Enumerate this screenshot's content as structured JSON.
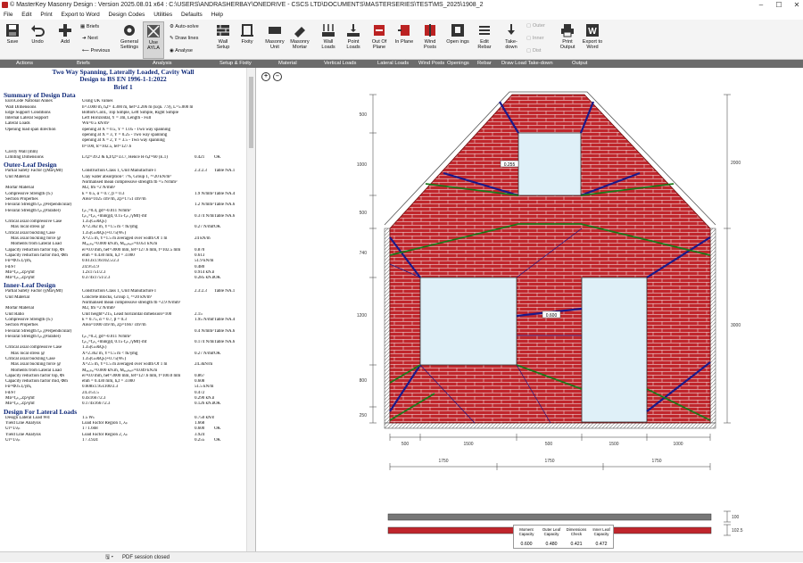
{
  "window": {
    "title": "© MasterKey Masonry Design : Version 2025.08.01 x64 : C:\\USERS\\ANDRASHERBAY\\ONEDRIVE - CSCS LTD\\DOCUMENTS\\MASTERSERIES\\TEST\\MS_2025\\1908_2",
    "minimize": "–",
    "maximize": "☐",
    "close": "✕"
  },
  "menu": [
    "File",
    "Edit",
    "Print",
    "Export to Word",
    "Design Codes",
    "Utilities",
    "Defaults",
    "Help"
  ],
  "ribbon": {
    "save": "Save",
    "undo": "Undo",
    "add": "Add",
    "briefs": "Briefs",
    "next": "Next",
    "previous": "Previous",
    "general_settings": "General Settings",
    "use_ayla": "Use AYLA",
    "auto_solve": "Auto-solve",
    "draw_lines": "Draw lines",
    "analyse": "Analyse",
    "wall_setup": "Wall Setup",
    "fixity": "Fixity",
    "masonry_unit": "Masonry Unit",
    "masonry_mortar": "Masonry Mortar",
    "wall_loads": "Wall Loads",
    "point_loads": "Point Loads",
    "out_of_plane": "Out Of Plane",
    "in_plane": "In Plane",
    "wind_posts": "Wind Posts",
    "openings": "Open ings",
    "edit_rebar": "Edit Rebar",
    "takedown": "Take- down",
    "outer": "Outer",
    "inner": "Inner",
    "dist": "Dist",
    "print_output": "Print Output",
    "export_word": "Export to Word"
  },
  "groups": [
    "Actions",
    "Briefs",
    "Analysis",
    "Setup & Fixity",
    "Material",
    "Vertical Loads",
    "Lateral Loads",
    "Wind Posts",
    "Openings",
    "Rebar",
    "Draw Load Take-down",
    "Output"
  ],
  "report": {
    "title1": "Two Way Spanning, Laterally Loaded, Cavity Wall",
    "title2": "Design to BS EN 1996-1-1:2022",
    "title3": "Brief 1",
    "sections": [
      {
        "heading": "Summary of Design Data",
        "rows": [
          [
            "EuroCode National Annex",
            "Using UK values",
            "",
            ""
          ],
          [
            "Wall Dimensions",
            "h=3.000 m, hₑf= 4.300 m, hef=2.206 m (Eqn. 7.9), L=5.000 m, Lₑf=5.000 m",
            "",
            ""
          ],
          [
            "Edge Support Conditions",
            "Bottom Cont., Top Simple, Left Simple, Right Simple",
            "",
            ""
          ],
          [
            "Internal Lateral Support",
            "Left Horizontal, Y = 3m, Length - Full",
            "",
            ""
          ],
          [
            "Lateral Loads",
            "Wk=0.5 kN/m²",
            "",
            ""
          ],
          [
            "Opening load span direction",
            "opening at X = 0.5, Y = 1.05 - Two way spanning",
            "",
            ""
          ],
          [
            "",
            "opening at X = 3, Y = 0.25 - Two way spanning",
            "",
            ""
          ],
          [
            "",
            "opening at X = 2, Y = 3.5 - Two way spanning",
            "",
            ""
          ],
          [
            "",
            "tl=100, tc=102.5, tef=127.6",
            "",
            ""
          ],
          [
            "Cavity Wall (mm)",
            "",
            "",
            ""
          ],
          [
            "Limiting Dimensions",
            "L/tₑf=39.2 & hₑf/tₑf=33.7, Hence H·hₑf=60 (E.1)",
            "0.421",
            "OK"
          ]
        ]
      },
      {
        "heading": "Outer-Leaf Design",
        "rows": [
          [
            "Partial Safety Factor (γMa/γMf)",
            "Construction Class 1, Unit Manufacture I",
            "2.3:2.3",
            "Table NA.1"
          ],
          [
            "Unit Material",
            "Clay water absorption< 7%, Group 1, ³=20 kN/m³",
            "",
            ""
          ],
          [
            "",
            "Normalised mean compressive strength  fb =5 N/mm²",
            "",
            ""
          ],
          [
            "Mortar Material",
            "M2, fm =2 N/mm²",
            "",
            ""
          ],
          [
            "Compressive Strength (fₖ)",
            "k = 0.5, α = 0.7, β = 0.3",
            "1.9 N/mm²",
            "Table NA.4"
          ],
          [
            "Section Properties",
            "Area=1025 cm²/m, Zp=1751 cm³/m",
            "",
            ""
          ],
          [
            "Flexural Strength fₓₖ₁(Perpendicular)",
            "",
            "1.2 N/mm²",
            "Table NA.6"
          ],
          [
            "Flexural Strength fₓₖ₂(Parallel)",
            "fₓₖ₁=0.4, gd=-0.011 N/mm²",
            "",
            ""
          ],
          [
            "",
            "fₓₖ₂=fₓₖ₁+min(gd, 0.15·fₓₖ₁/γMf)·mf",
            "0.374 N/mm²",
            "Table NA.6"
          ],
          [
            "Critical axial compressive Case",
            "1.35(Gₖ&Qₖ)",
            "",
            ""
          ],
          [
            "Max local stress @",
            "X=2.362 m, Y=1.5 m < fk/γmg",
            "0.27 N/mm²",
            "OK"
          ],
          [
            "Critical axial buckling Case",
            "1.35(Gₖ&Qₖ)+0.75(Wₖ)",
            "",
            ""
          ],
          [
            "Max axial buckling force @",
            "X=2.5 m, Y=1.5 m averaged over width Of 1 m",
            "24 kN/m",
            ""
          ],
          [
            "Moments from Lateral Load",
            "Mₓₓ,ₚₐᵣ=0.000 kN.m, Mₓₓ,ₚₑᵣₚ=0.051 kN.m",
            "",
            ""
          ],
          [
            "Capacity reduction factor top, Φi",
            "ei=0.0 mm, hef=3000 mm, tef=127.6 mm, t=102.5 mm",
            "0.870",
            ""
          ],
          [
            "Capacity reduction factor mid, Φm",
            "ehm = 0.430 mm, hₑf = 3.000",
            "0.613",
            ""
          ],
          [
            "Fᴅ=Φ.fₖ.tᵢ/γmₐ",
            "0.613x1.9x102.5/2.3",
            "51.9 kN/m",
            ""
          ],
          [
            "Fd/Fr",
            "24.9/51.9",
            "0.480",
            ""
          ],
          [
            "Mᴅ=fₓₖ₂.Zp/γmf",
            "1.2x1751/2.3",
            "0.914 kN.m",
            ""
          ],
          [
            "Mᴅ=fₓₖ₁.Zp/γmf",
            "0.374x1751/2.3",
            "0.285 kN.m",
            "OK"
          ]
        ]
      },
      {
        "heading": "Inner-Leaf Design",
        "rows": [
          [
            "Partial Safety Factor (γMa/γMf)",
            "Construction Class 1, Unit Manufacture I",
            "2.3:2.3",
            "Table NA.1"
          ],
          [
            "Unit Material",
            "Concrete Blocks, Group 1, ³=20 kN/m³",
            "",
            ""
          ],
          [
            "",
            "Normalised mean compressive strength  fb =2.9 N/mm²",
            "",
            ""
          ],
          [
            "Mortar Material",
            "M2, fm =2 N/mm²",
            "",
            ""
          ],
          [
            "Unit Ratio",
            "Unit height=215, Least horizontal dimension=100",
            "2.15",
            ""
          ],
          [
            "Compressive Strength (fₖ)",
            "k = 0.75, α = 0.7, β = 0.3",
            "1.95 N/mm²",
            "Table NA.4"
          ],
          [
            "Section Properties",
            "Area=1000 cm²/m, Zp=1667 cm³/m",
            "",
            ""
          ],
          [
            "Flexural Strength fₓₖ₁(Perpendicular)",
            "",
            "0.4 N/mm²",
            "Table NA.6"
          ],
          [
            "Flexural Strength fₓₖ₂(Parallel)",
            "fₓₖ₁=0.2, gd=-0.011 N/mm²",
            "",
            ""
          ],
          [
            "",
            "fₓₖ₂=fₓₖ₁+min(gd, 0.15·fₓₖ₁/γMf)·mf",
            "0.174 N/mm²",
            "Table NA.6"
          ],
          [
            "Critical axial compressive Case",
            "1.35(Gₖ&Qₖ)",
            "",
            ""
          ],
          [
            "Max local stress @",
            "X=2.362 m, Y=1.5 m < fk/γmg",
            "0.27 N/mm²",
            "OK"
          ],
          [
            "Critical axial buckling Case",
            "1.35(Gₖ&Qₖ)+0.75(Wₖ)",
            "",
            ""
          ],
          [
            "Max axial buckling force @",
            "X=2.5 m, Y=1.5 m averaged over width Of 1 m",
            "24.3kN/m",
            ""
          ],
          [
            "Moments from Lateral Load",
            "Mₓₓ,ₚₐᵣ=0.000 kN.m, Mₓₓ,ₚₑᵣₚ=0.049 kN.m",
            "",
            ""
          ],
          [
            "Capacity reduction factor top, Φi",
            "ei=0.0 mm, hef=3000 mm, tef=127.6 mm, t=100.0 mm",
            "0.867",
            ""
          ],
          [
            "Capacity reduction factor mid, Φm",
            "ehm = 0.430 mm, hₑf = 3.000",
            "0.608",
            ""
          ],
          [
            "Fᴅ=Φ.fₖ.tᵢ/γmₐ",
            "0.608x1.95x100/2.3",
            "51.5 kN/m",
            ""
          ],
          [
            "Fd/Fr",
            "24.3/51.5",
            "0.472",
            ""
          ],
          [
            "Mᴅ=fₓₖ₂.Zp/γmf",
            "0.4x1667/2.3",
            "0.290 kN.m",
            ""
          ],
          [
            "Mᴅ=fₓₖ₁.Zp/γmf",
            "0.174x1667/2.3",
            "0.126 kN.m",
            "OK"
          ]
        ]
      },
      {
        "heading": "Design For Lateral Loads",
        "rows": [
          [
            "Design Lateral Load Wd",
            "1.5 Wₖ",
            "0.750 kN/m²",
            ""
          ],
          [
            "Yield Line Analysis",
            "Load Factor Region 1, λₚ",
            "1.668",
            ""
          ],
          [
            "Ur=1/λₚ",
            "1 / 1.668",
            "0.600",
            "OK"
          ],
          [
            "Yield Line Analysis",
            "Load Factor Region 2, λₚ",
            "3.924",
            ""
          ],
          [
            "Ur=1/λₚ",
            "1 / 3.924",
            "0.255",
            "OK"
          ]
        ]
      }
    ]
  },
  "drawing": {
    "wall": {
      "width_mm": 5000,
      "base_height_mm": 3000,
      "gable_height_mm": 2000,
      "brick_color": "#c0262c",
      "mortar_color": "#e8c8c8"
    },
    "dims_top_right": [
      "2000"
    ],
    "dims_right": [
      "3000"
    ],
    "dims_left_gable": [
      "500",
      "1000",
      "500"
    ],
    "dims_left_base": [
      "740",
      "1200",
      "800",
      "250"
    ],
    "dims_bottom_1": [
      "500",
      "1500",
      "500",
      "1500",
      "1000"
    ],
    "dims_bottom_2": [
      "1750",
      "1750",
      "1750"
    ],
    "region_labels": [
      "0.255",
      "0.600"
    ],
    "leaf_bars": {
      "outer_label": "100",
      "inner_label": "102.5",
      "outer_color": "#777777",
      "inner_color": "#c0262c"
    },
    "yield_colors": {
      "positive": "#1a1a8a",
      "negative": "#1a7a1a"
    }
  },
  "results_table": {
    "headers": [
      "Moment Capacity",
      "Outer Leaf Capacity",
      "Dimensions Check",
      "Inner Leaf Capacity"
    ],
    "values": [
      "0.600",
      "0.480",
      "0.421",
      "0.472"
    ]
  },
  "status": {
    "text": "PDF session closed"
  }
}
